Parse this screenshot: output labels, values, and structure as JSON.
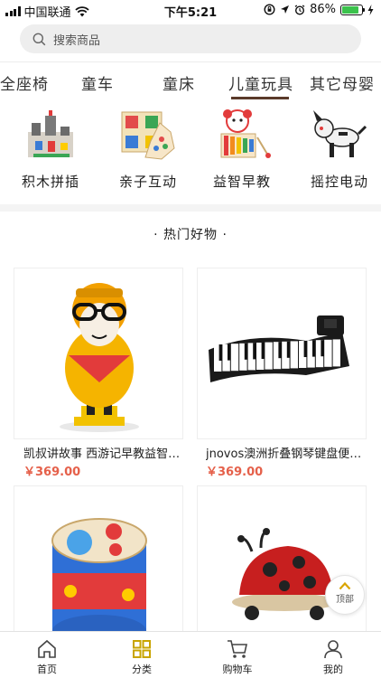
{
  "status_bar": {
    "carrier": "中国联通",
    "time": "下午5:21",
    "battery": "86%",
    "battery_level": 0.86
  },
  "search": {
    "placeholder": "搜索商品",
    "icon": "search-icon"
  },
  "category_tabs": [
    {
      "label": "全座椅",
      "active": false
    },
    {
      "label": "童车",
      "active": false
    },
    {
      "label": "童床",
      "active": false
    },
    {
      "label": "儿童玩具",
      "active": true
    },
    {
      "label": "其它母婴",
      "active": false
    }
  ],
  "subcategories": [
    {
      "label": "积木拼插",
      "icon": "building-blocks-image"
    },
    {
      "label": "亲子互动",
      "icon": "board-game-image"
    },
    {
      "label": "益智早教",
      "icon": "xylophone-image"
    },
    {
      "label": "摇控电动",
      "icon": "robot-dog-image"
    }
  ],
  "hot_section": {
    "title": "· 热门好物 ·"
  },
  "products": [
    {
      "name": "凯叔讲故事 西游记早教益智故事机",
      "price": "￥369.00",
      "image": "monkey-king-toy-image"
    },
    {
      "name": "jnovos澳洲折叠钢琴键盘便携式",
      "price": "￥369.00",
      "image": "roll-up-piano-image"
    },
    {
      "name": "",
      "price": "",
      "image": "drum-toy-image"
    },
    {
      "name": "",
      "price": "",
      "image": "ladybug-ride-on-image"
    }
  ],
  "back_to_top": {
    "label": "顶部",
    "icon": "chevron-up-icon"
  },
  "bottom_nav": [
    {
      "label": "首页",
      "icon": "home-icon",
      "active": false
    },
    {
      "label": "分类",
      "icon": "grid-icon",
      "active": true
    },
    {
      "label": "购物车",
      "icon": "cart-icon",
      "active": false
    },
    {
      "label": "我的",
      "icon": "user-icon",
      "active": false
    }
  ],
  "colors": {
    "accent": "#5a3a2a",
    "price": "#e5604a",
    "active_nav": "#c8a400",
    "battery": "#3bc24c"
  }
}
